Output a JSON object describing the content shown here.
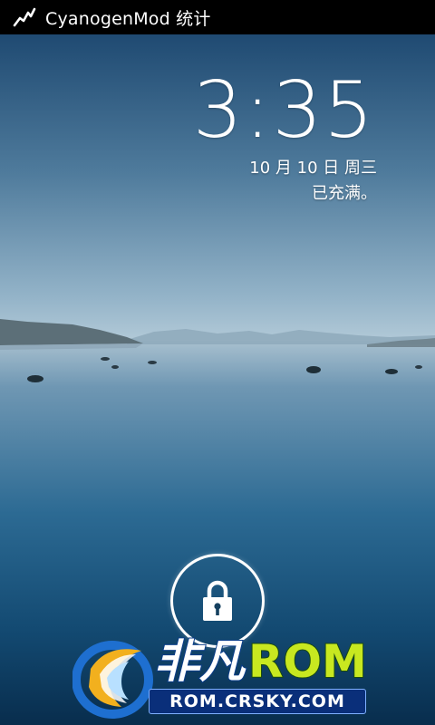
{
  "status_bar": {
    "app_title": "CyanogenMod 统计",
    "icon": "stats-graph-icon"
  },
  "lockscreen": {
    "time": "3:35",
    "date": "10 月 10 日 周三",
    "charging_status": "已充满。",
    "unlock_icon": "lock-icon"
  },
  "watermark": {
    "brand_cn": "非凡",
    "brand_en": "ROM",
    "url": "ROM.CRSKY.COM"
  },
  "colors": {
    "status_bar_bg": "#000000",
    "sky_top": "#1f4d78",
    "horizon": "#a9c3d2",
    "water_deep": "#0b3658",
    "text": "#ffffff",
    "watermark_rom": "#c8e820",
    "watermark_url_bg": "#0a2f7a"
  }
}
